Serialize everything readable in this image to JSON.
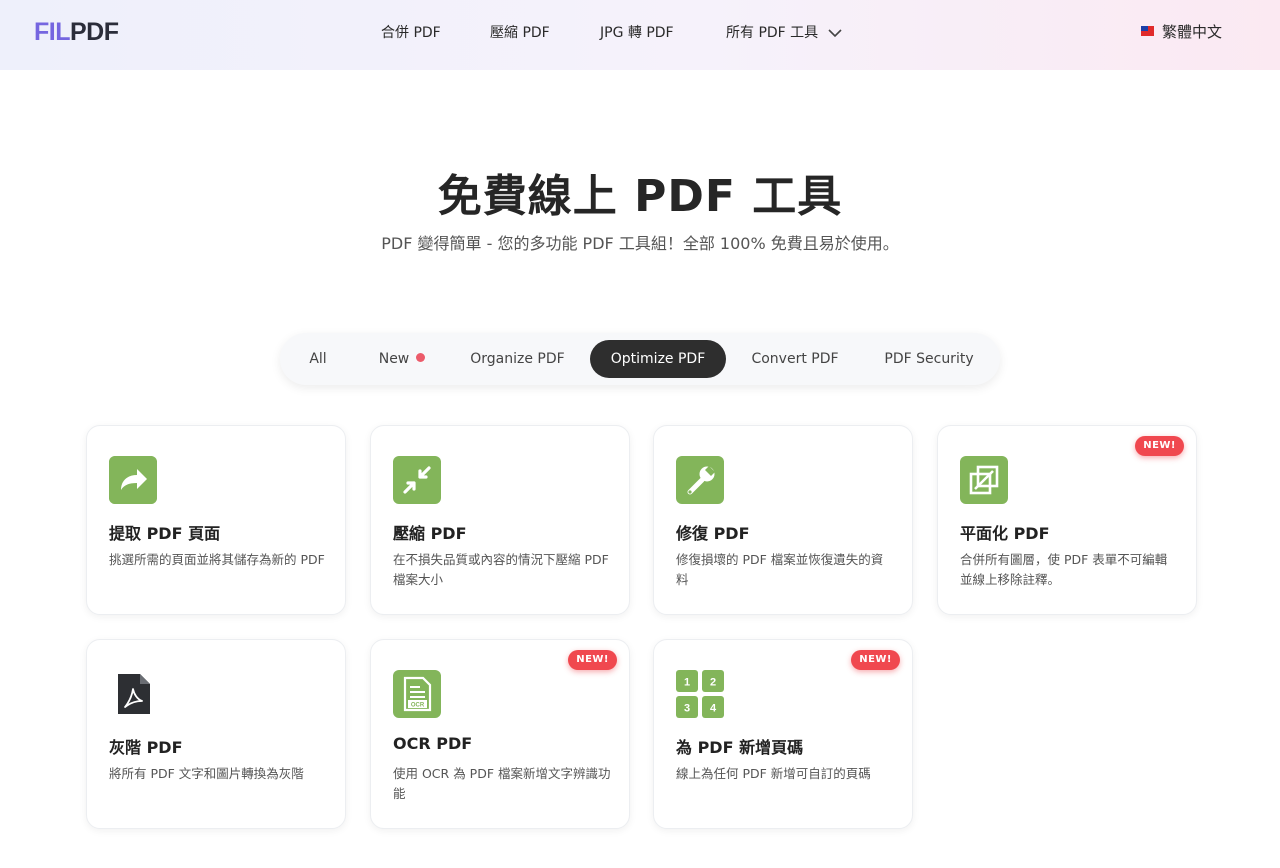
{
  "header": {
    "logo_part1": "FIL",
    "logo_part2": "PDF",
    "nav": [
      {
        "label": "合併 PDF"
      },
      {
        "label": "壓縮 PDF"
      },
      {
        "label": "JPG 轉 PDF"
      },
      {
        "label": "所有 PDF 工具"
      }
    ],
    "language": "繁體中文"
  },
  "hero": {
    "title": "免費線上 PDF 工具",
    "subtitle": "PDF 變得簡單 - 您的多功能 PDF 工具組！全部 100% 免費且易於使用。"
  },
  "tabs": [
    {
      "label": "All"
    },
    {
      "label": "New"
    },
    {
      "label": "Organize PDF"
    },
    {
      "label": "Optimize PDF"
    },
    {
      "label": "Convert PDF"
    },
    {
      "label": "PDF Security"
    }
  ],
  "active_tab": "Optimize PDF",
  "badge_label": "NEW!",
  "ocr_icon_text": "OCR",
  "number_icon": [
    "1",
    "2",
    "3",
    "4"
  ],
  "cards": [
    {
      "title": "提取 PDF 頁面",
      "desc": "挑選所需的頁面並將其儲存為新的 PDF",
      "icon": "share-arrow-icon",
      "new": false
    },
    {
      "title": "壓縮 PDF",
      "desc": "在不損失品質或內容的情況下壓縮 PDF 檔案大小",
      "icon": "compress-arrows-icon",
      "new": false
    },
    {
      "title": "修復 PDF",
      "desc": "修復損壞的 PDF 檔案並恢復遺失的資料",
      "icon": "wrench-icon",
      "new": false
    },
    {
      "title": "平面化 PDF",
      "desc": "合併所有圖層，使 PDF 表單不可編輯並線上移除註釋。",
      "icon": "flatten-layers-icon",
      "new": true
    },
    {
      "title": "灰階 PDF",
      "desc": "將所有 PDF 文字和圖片轉換為灰階",
      "icon": "pdf-file-icon",
      "new": false
    },
    {
      "title": "OCR PDF",
      "desc": "使用 OCR 為 PDF 檔案新增文字辨識功能",
      "icon": "ocr-document-icon",
      "new": true
    },
    {
      "title": "為 PDF 新增頁碼",
      "desc": "線上為任何 PDF 新增可自訂的頁碼",
      "icon": "page-numbers-icon",
      "new": true
    }
  ],
  "colors": {
    "brand_purple": "#7566e0",
    "icon_green": "#83b55a",
    "badge_red": "#f0484f",
    "active_tab": "#2e2e2e"
  }
}
